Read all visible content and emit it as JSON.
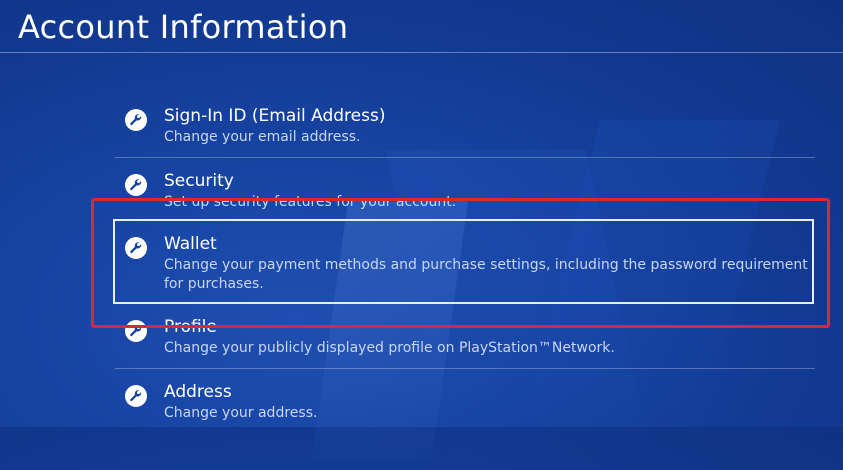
{
  "title": "Account Information",
  "items": [
    {
      "label": "Sign-In ID (Email Address)",
      "desc": "Change your email address."
    },
    {
      "label": "Security",
      "desc": "Set up security features for your account."
    },
    {
      "label": "Wallet",
      "desc": "Change your payment methods and purchase settings, including the password requirement for purchases."
    },
    {
      "label": "Profile",
      "desc": "Change your publicly displayed profile on PlayStation™Network."
    },
    {
      "label": "Address",
      "desc": "Change your address."
    }
  ],
  "icon": "wrench-icon",
  "colors": {
    "background": "#1744a3",
    "highlight_annotation": "#e02630",
    "focus_border": "#e8eef8"
  },
  "selected_item": "Wallet"
}
